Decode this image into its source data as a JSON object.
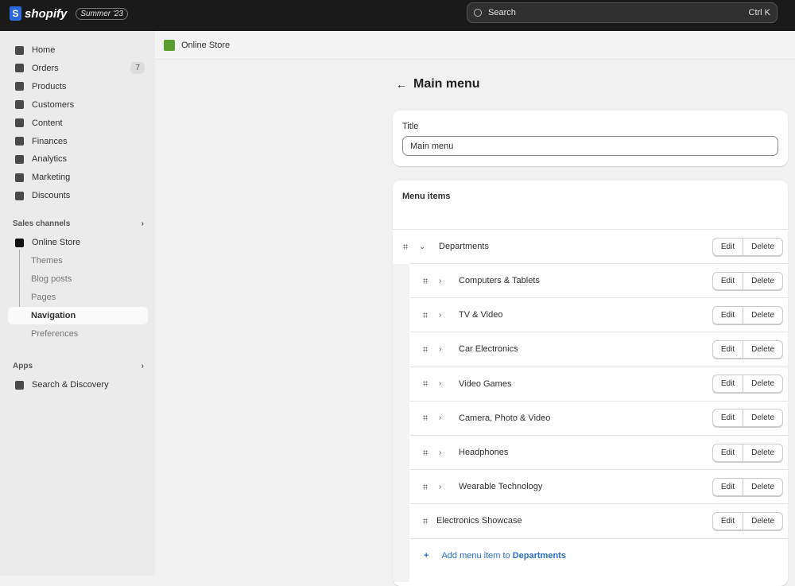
{
  "topbar": {
    "brand": "shopify",
    "edition": "Summer '23",
    "search_placeholder": "Search",
    "search_shortcut": "Ctrl K"
  },
  "sidebar": {
    "main": [
      {
        "label": "Home",
        "icon": "home-icon"
      },
      {
        "label": "Orders",
        "icon": "inbox-icon",
        "count": "7"
      },
      {
        "label": "Products",
        "icon": "tag-icon"
      },
      {
        "label": "Customers",
        "icon": "person-icon"
      },
      {
        "label": "Content",
        "icon": "image-icon"
      },
      {
        "label": "Finances",
        "icon": "bank-icon"
      },
      {
        "label": "Analytics",
        "icon": "bar-chart-icon"
      },
      {
        "label": "Marketing",
        "icon": "target-icon"
      },
      {
        "label": "Discounts",
        "icon": "discount-icon"
      }
    ],
    "sales_channels_label": "Sales channels",
    "online_store": "Online Store",
    "sub": [
      "Themes",
      "Blog posts",
      "Pages",
      "Navigation",
      "Preferences"
    ],
    "active": "Navigation",
    "apps_label": "Apps",
    "app": "Search & Discovery"
  },
  "breadcrumb": "Online Store",
  "page": {
    "title": "Main menu"
  },
  "title_card": {
    "label": "Title",
    "value": "Main menu"
  },
  "menu_items": {
    "heading": "Menu items",
    "parent": "Departments",
    "children": [
      {
        "label": "Computers & Tablets",
        "expandable": true
      },
      {
        "label": "TV & Video",
        "expandable": true
      },
      {
        "label": "Car Electronics",
        "expandable": true
      },
      {
        "label": "Video Games",
        "expandable": true
      },
      {
        "label": "Camera, Photo & Video",
        "expandable": true
      },
      {
        "label": "Headphones",
        "expandable": true
      },
      {
        "label": "Wearable Technology",
        "expandable": true
      },
      {
        "label": "Electronics Showcase",
        "expandable": false
      }
    ],
    "edit": "Edit",
    "delete": "Delete",
    "add_prefix": "Add menu item to",
    "add_target": "Departments"
  },
  "colors": {
    "topbar": "#1a1a1a",
    "link": "#2c6ecb",
    "brand": "#2d6ae0"
  }
}
